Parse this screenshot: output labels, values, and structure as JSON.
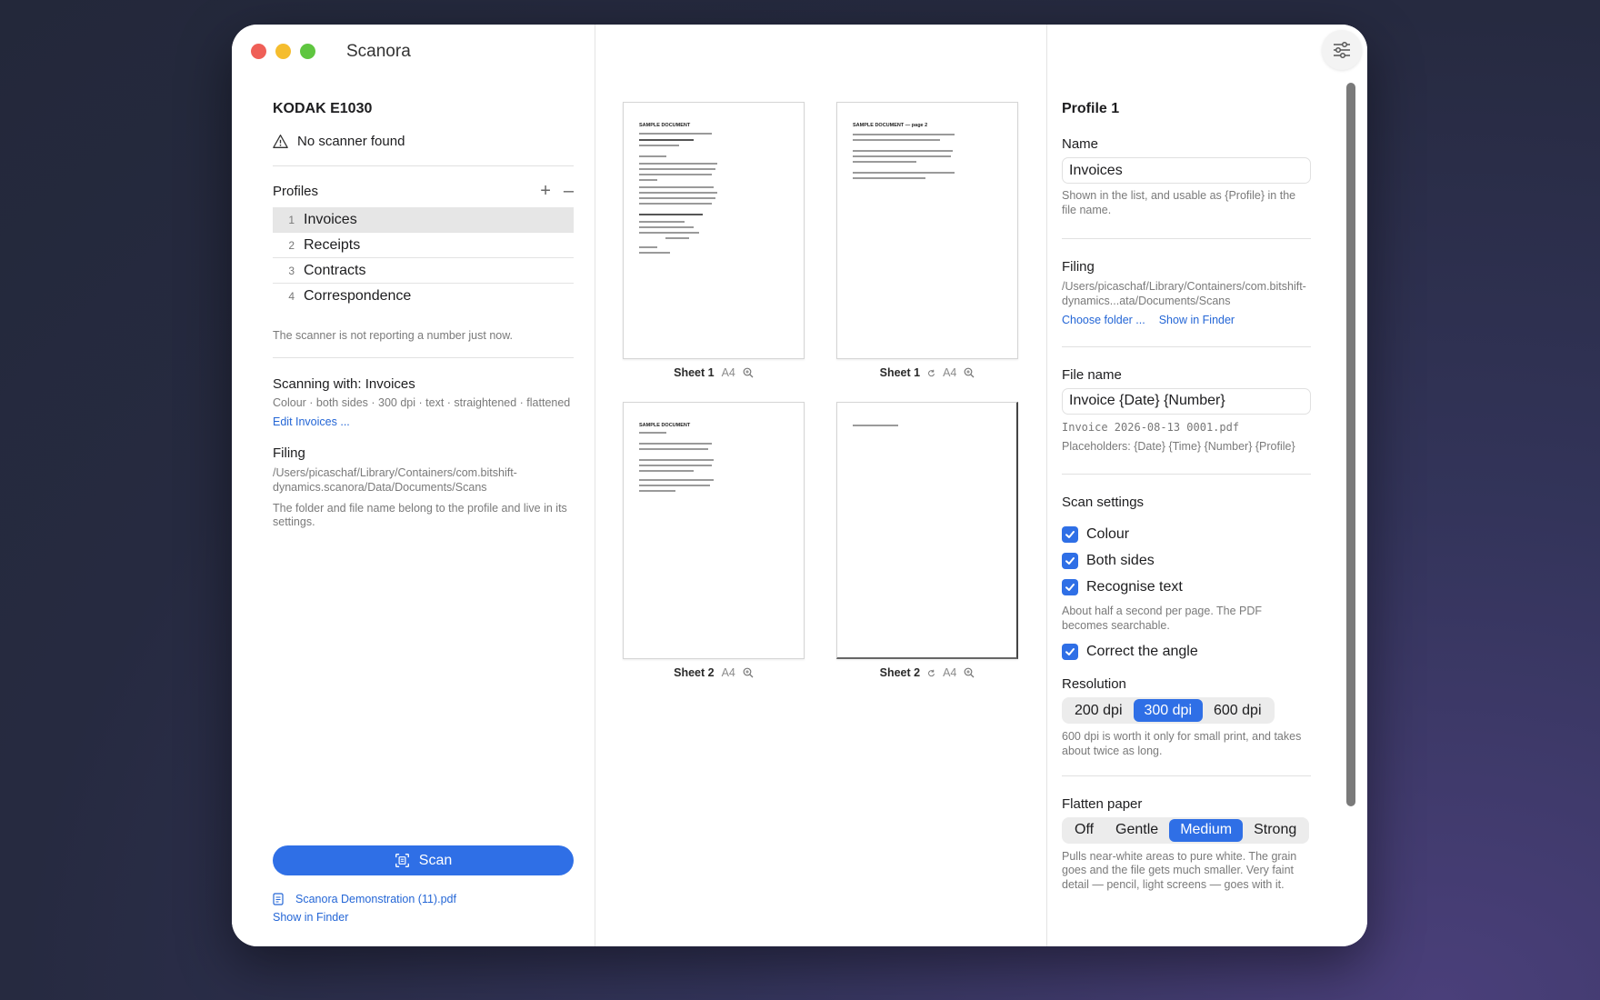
{
  "app": {
    "title": "Scanora"
  },
  "sidebar": {
    "scanner_name": "KODAK E1030",
    "scanner_status": "No scanner found",
    "profiles_label": "Profiles",
    "add_symbol": "+",
    "remove_symbol": "–",
    "profiles": [
      {
        "num": "1",
        "name": "Invoices"
      },
      {
        "num": "2",
        "name": "Receipts"
      },
      {
        "num": "3",
        "name": "Contracts"
      },
      {
        "num": "4",
        "name": "Correspondence"
      }
    ],
    "number_note": "The scanner is not reporting a number just now.",
    "scanning_with": "Scanning with: Invoices",
    "scanning_summary": "Colour · both sides · 300 dpi · text · straightened · flattened",
    "edit_link": "Edit Invoices ...",
    "filing_title": "Filing",
    "filing_path": "/Users/picaschaf/Library/Containers/com.bitshift-dynamics.scanora/Data/Documents/Scans",
    "filing_note": "The folder and file name belong to the profile and live in its settings.",
    "scan_label": "Scan",
    "last_file": "Scanora Demonstration (11).pdf",
    "show_in_finder": "Show in Finder"
  },
  "sheets": [
    {
      "label": "Sheet 1",
      "size": "A4",
      "title": "SAMPLE DOCUMENT",
      "rotate": false
    },
    {
      "label": "Sheet 1",
      "size": "A4",
      "title": "SAMPLE DOCUMENT — page 2",
      "rotate": true
    },
    {
      "label": "Sheet 2",
      "size": "A4",
      "title": "SAMPLE DOCUMENT",
      "rotate": false
    },
    {
      "label": "Sheet 2",
      "size": "A4",
      "title": "",
      "rotate": true
    }
  ],
  "panel": {
    "profile_title": "Profile 1",
    "name_label": "Name",
    "name_value": "Invoices",
    "name_hint": "Shown in the list, and usable as {Profile} in the file name.",
    "filing_label": "Filing",
    "filing_path": "/Users/picaschaf/Library/Containers/com.bitshift-dynamics...ata/Documents/Scans",
    "choose_folder": "Choose folder ...",
    "show_in_finder": "Show in Finder",
    "filename_label": "File name",
    "filename_value": "Invoice {Date} {Number}",
    "filename_preview": "Invoice 2026-08-13 0001.pdf",
    "placeholders": "Placeholders: {Date} {Time} {Number} {Profile}",
    "scan_settings_label": "Scan settings",
    "colour": "Colour",
    "both_sides": "Both sides",
    "recognise_text": "Recognise text",
    "recognise_hint": "About half a second per page. The PDF becomes searchable.",
    "correct_angle": "Correct the angle",
    "resolution_label": "Resolution",
    "resolutions": [
      "200 dpi",
      "300 dpi",
      "600 dpi"
    ],
    "resolution_selected": "300 dpi",
    "resolution_hint": "600 dpi is worth it only for small print, and takes about twice as long.",
    "flatten_label": "Flatten paper",
    "flatten_options": [
      "Off",
      "Gentle",
      "Medium",
      "Strong"
    ],
    "flatten_selected": "Medium",
    "flatten_hint": "Pulls near-white areas to pure white. The grain goes and the file gets much smaller. Very faint detail — pencil, light screens — goes with it."
  },
  "colors": {
    "accent": "#2f6fe6",
    "link": "#2466d6"
  }
}
